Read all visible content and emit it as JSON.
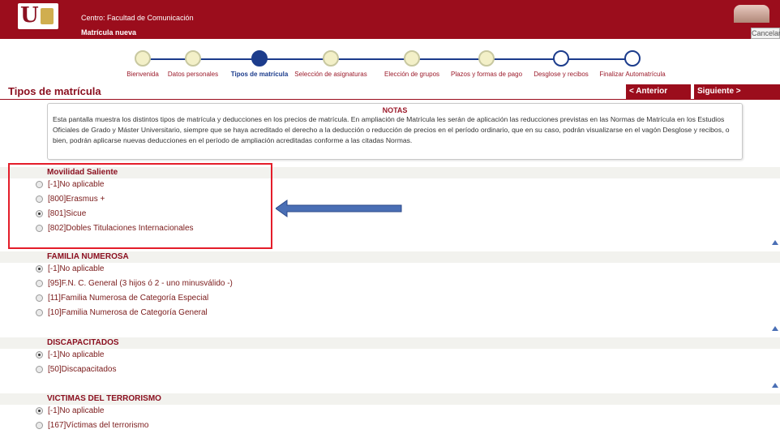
{
  "header": {
    "centro": "Centro: Facultad de Comunicación",
    "subtitle": "Matrícula nueva",
    "cancel_label": "Cancelar"
  },
  "steps": [
    {
      "label": "Bienvenida",
      "state": "done"
    },
    {
      "label": "Datos personales",
      "state": "done"
    },
    {
      "label": "Tipos de matrícula",
      "state": "current"
    },
    {
      "label": "Selección de asignaturas",
      "state": "done"
    },
    {
      "label": "Elección de grupos",
      "state": "done"
    },
    {
      "label": "Plazos y formas de pago",
      "state": "done"
    },
    {
      "label": "Desglose y recibos",
      "state": "todo"
    },
    {
      "label": "Finalizar Automatrícula",
      "state": "todo"
    }
  ],
  "page": {
    "title": "Tipos de matrícula",
    "prev_label": "< Anterior",
    "next_label": "Siguiente >"
  },
  "notes": {
    "title": "NOTAS",
    "text": "Esta pantalla muestra los distintos tipos de matrícula y deducciones en los precios de matrícula. En ampliación de Matrícula les serán de aplicación las reducciones previstas en las Normas de Matrícula en los Estudios Oficiales de Grado y Máster Universitario, siempre que se haya acreditado el derecho a la deducción o reducción de precios en el período ordinario, que en su caso, podrán visualizarse en el vagón Desglose y recibos, o bien, podrán aplicarse nuevas deducciones en el período de ampliación acreditadas conforme a las citadas Normas."
  },
  "sections": [
    {
      "title": "Movilidad Saliente",
      "options": [
        {
          "label": "[-1]No aplicable",
          "checked": false
        },
        {
          "label": "[800]Erasmus +",
          "checked": false
        },
        {
          "label": "[801]Sicue",
          "checked": true
        },
        {
          "label": "[802]Dobles Titulaciones Internacionales",
          "checked": false
        }
      ]
    },
    {
      "title": "FAMILIA NUMEROSA",
      "options": [
        {
          "label": "[-1]No aplicable",
          "checked": true
        },
        {
          "label": "[95]F.N. C. General (3 hijos ó 2 - uno minusválido -)",
          "checked": false
        },
        {
          "label": "[11]Familia Numerosa de Categoría Especial",
          "checked": false
        },
        {
          "label": "[10]Familia Numerosa de Categoría General",
          "checked": false
        }
      ]
    },
    {
      "title": "DISCAPACITADOS",
      "options": [
        {
          "label": "[-1]No aplicable",
          "checked": true
        },
        {
          "label": "[50]Discapacitados",
          "checked": false
        }
      ]
    },
    {
      "title": "VICTIMAS DEL TERRORISMO",
      "options": [
        {
          "label": "[-1]No aplicable",
          "checked": true
        },
        {
          "label": "[167]Víctimas del terrorismo",
          "checked": false
        }
      ]
    }
  ],
  "colors": {
    "brand": "#9b0d1c",
    "step_blue": "#1c3c8c",
    "highlight": "#e41d2a"
  },
  "icons": [
    "university-logo",
    "avatar",
    "scroll-up-icon",
    "arrow-pointer-icon"
  ]
}
